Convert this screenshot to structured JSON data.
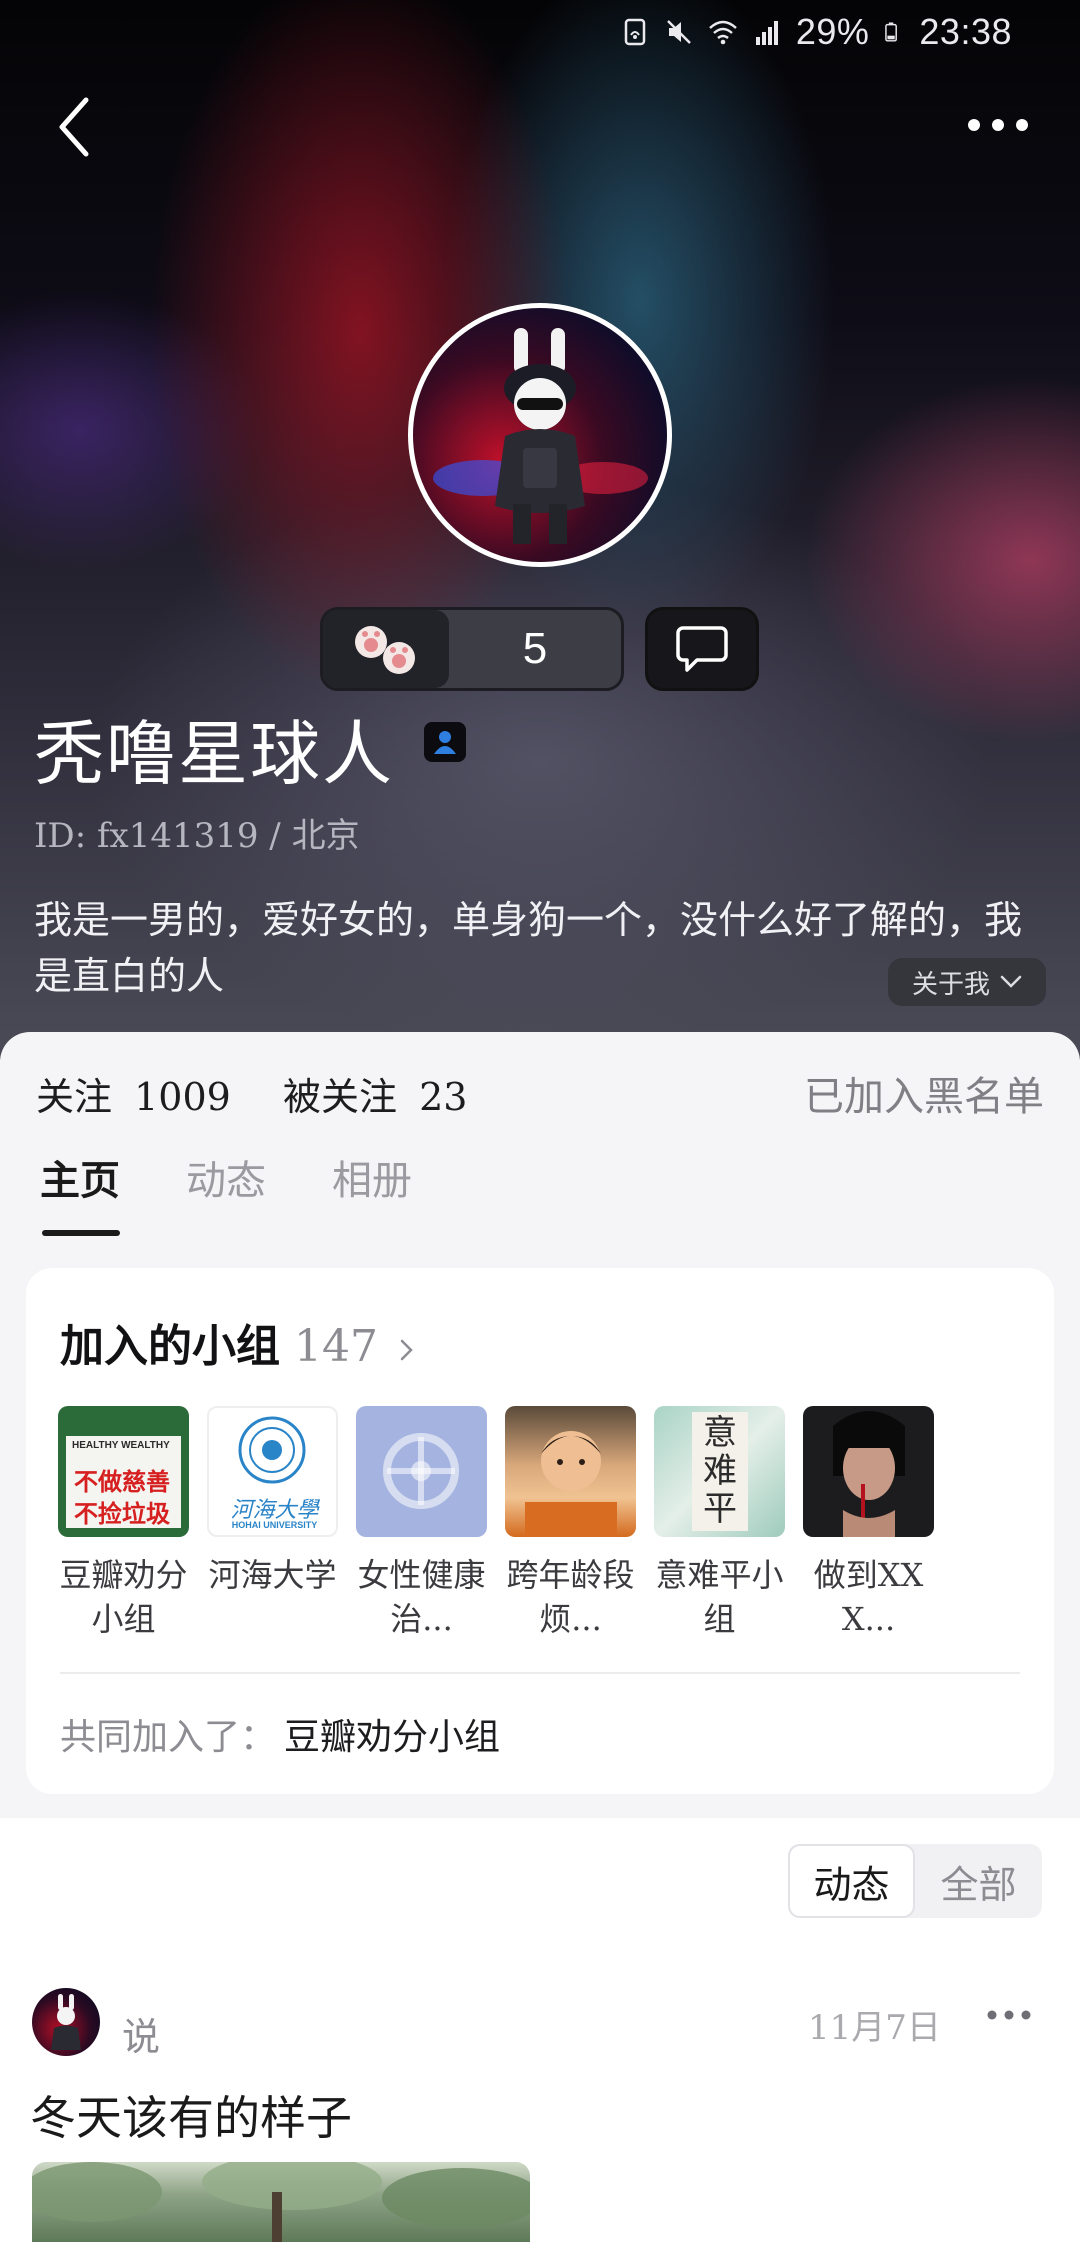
{
  "status_bar": {
    "battery_percent": "29%",
    "time": "23:38",
    "icons": [
      "nfc-icon",
      "mute-icon",
      "wifi-icon",
      "signal-icon",
      "battery-icon"
    ]
  },
  "header": {
    "back_icon": "chevron-left-icon",
    "more_icon": "more-dots-icon"
  },
  "profile": {
    "name": "秃噜星球人",
    "id_line": "ID: fx141319 / 北京",
    "bio": "我是一男的，爱好女的，单身狗一个，没什么好了解的，我是直白的人",
    "about_label": "关于我",
    "likes_count": "5"
  },
  "stats": {
    "following_label": "关注",
    "following_count": "1009",
    "followers_label": "被关注",
    "followers_count": "23",
    "blacklist_label": "已加入黑名单"
  },
  "tabs": [
    {
      "label": "主页",
      "active": true
    },
    {
      "label": "动态",
      "active": false
    },
    {
      "label": "相册",
      "active": false
    }
  ],
  "groups": {
    "title": "加入的小组",
    "count": "147",
    "items": [
      {
        "label": "豆瓣劝分小组"
      },
      {
        "label": "河海大学"
      },
      {
        "label": "女性健康治..."
      },
      {
        "label": "跨年龄段烦..."
      },
      {
        "label": "意难平小组"
      },
      {
        "label": "做到XXX..."
      }
    ],
    "thumb_texts": {
      "g1_top": "HEALTHY WEALTHY",
      "g1_line1": "不做慈善",
      "g1_line2": "不捡垃圾",
      "g2_name": "河海大學",
      "g2_en": "HOHAI UNIVERSITY",
      "g5_text": "意难平"
    },
    "common_label": "共同加入了：",
    "common_group": "豆瓣劝分小组"
  },
  "feed": {
    "filter": [
      {
        "label": "动态",
        "active": true
      },
      {
        "label": "全部",
        "active": false
      }
    ],
    "post": {
      "verb": "说",
      "date": "11月7日",
      "text": "冬天该有的样子"
    }
  },
  "colors": {
    "accent_badge": "#2e7fe0",
    "sheet_bg": "#f5f5f7",
    "hero_dark": "#0e0c16"
  }
}
